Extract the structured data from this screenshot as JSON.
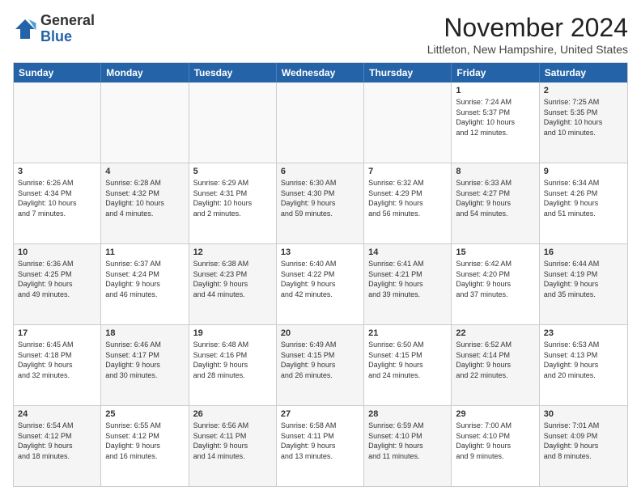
{
  "logo": {
    "general": "General",
    "blue": "Blue"
  },
  "header": {
    "month": "November 2024",
    "location": "Littleton, New Hampshire, United States"
  },
  "days": [
    "Sunday",
    "Monday",
    "Tuesday",
    "Wednesday",
    "Thursday",
    "Friday",
    "Saturday"
  ],
  "rows": [
    [
      {
        "num": "",
        "text": "",
        "empty": true
      },
      {
        "num": "",
        "text": "",
        "empty": true
      },
      {
        "num": "",
        "text": "",
        "empty": true
      },
      {
        "num": "",
        "text": "",
        "empty": true
      },
      {
        "num": "",
        "text": "",
        "empty": true
      },
      {
        "num": "1",
        "text": "Sunrise: 7:24 AM\nSunset: 5:37 PM\nDaylight: 10 hours\nand 12 minutes.",
        "alt": false
      },
      {
        "num": "2",
        "text": "Sunrise: 7:25 AM\nSunset: 5:35 PM\nDaylight: 10 hours\nand 10 minutes.",
        "alt": true
      }
    ],
    [
      {
        "num": "3",
        "text": "Sunrise: 6:26 AM\nSunset: 4:34 PM\nDaylight: 10 hours\nand 7 minutes.",
        "alt": false
      },
      {
        "num": "4",
        "text": "Sunrise: 6:28 AM\nSunset: 4:32 PM\nDaylight: 10 hours\nand 4 minutes.",
        "alt": true
      },
      {
        "num": "5",
        "text": "Sunrise: 6:29 AM\nSunset: 4:31 PM\nDaylight: 10 hours\nand 2 minutes.",
        "alt": false
      },
      {
        "num": "6",
        "text": "Sunrise: 6:30 AM\nSunset: 4:30 PM\nDaylight: 9 hours\nand 59 minutes.",
        "alt": true
      },
      {
        "num": "7",
        "text": "Sunrise: 6:32 AM\nSunset: 4:29 PM\nDaylight: 9 hours\nand 56 minutes.",
        "alt": false
      },
      {
        "num": "8",
        "text": "Sunrise: 6:33 AM\nSunset: 4:27 PM\nDaylight: 9 hours\nand 54 minutes.",
        "alt": true
      },
      {
        "num": "9",
        "text": "Sunrise: 6:34 AM\nSunset: 4:26 PM\nDaylight: 9 hours\nand 51 minutes.",
        "alt": false
      }
    ],
    [
      {
        "num": "10",
        "text": "Sunrise: 6:36 AM\nSunset: 4:25 PM\nDaylight: 9 hours\nand 49 minutes.",
        "alt": true
      },
      {
        "num": "11",
        "text": "Sunrise: 6:37 AM\nSunset: 4:24 PM\nDaylight: 9 hours\nand 46 minutes.",
        "alt": false
      },
      {
        "num": "12",
        "text": "Sunrise: 6:38 AM\nSunset: 4:23 PM\nDaylight: 9 hours\nand 44 minutes.",
        "alt": true
      },
      {
        "num": "13",
        "text": "Sunrise: 6:40 AM\nSunset: 4:22 PM\nDaylight: 9 hours\nand 42 minutes.",
        "alt": false
      },
      {
        "num": "14",
        "text": "Sunrise: 6:41 AM\nSunset: 4:21 PM\nDaylight: 9 hours\nand 39 minutes.",
        "alt": true
      },
      {
        "num": "15",
        "text": "Sunrise: 6:42 AM\nSunset: 4:20 PM\nDaylight: 9 hours\nand 37 minutes.",
        "alt": false
      },
      {
        "num": "16",
        "text": "Sunrise: 6:44 AM\nSunset: 4:19 PM\nDaylight: 9 hours\nand 35 minutes.",
        "alt": true
      }
    ],
    [
      {
        "num": "17",
        "text": "Sunrise: 6:45 AM\nSunset: 4:18 PM\nDaylight: 9 hours\nand 32 minutes.",
        "alt": false
      },
      {
        "num": "18",
        "text": "Sunrise: 6:46 AM\nSunset: 4:17 PM\nDaylight: 9 hours\nand 30 minutes.",
        "alt": true
      },
      {
        "num": "19",
        "text": "Sunrise: 6:48 AM\nSunset: 4:16 PM\nDaylight: 9 hours\nand 28 minutes.",
        "alt": false
      },
      {
        "num": "20",
        "text": "Sunrise: 6:49 AM\nSunset: 4:15 PM\nDaylight: 9 hours\nand 26 minutes.",
        "alt": true
      },
      {
        "num": "21",
        "text": "Sunrise: 6:50 AM\nSunset: 4:15 PM\nDaylight: 9 hours\nand 24 minutes.",
        "alt": false
      },
      {
        "num": "22",
        "text": "Sunrise: 6:52 AM\nSunset: 4:14 PM\nDaylight: 9 hours\nand 22 minutes.",
        "alt": true
      },
      {
        "num": "23",
        "text": "Sunrise: 6:53 AM\nSunset: 4:13 PM\nDaylight: 9 hours\nand 20 minutes.",
        "alt": false
      }
    ],
    [
      {
        "num": "24",
        "text": "Sunrise: 6:54 AM\nSunset: 4:12 PM\nDaylight: 9 hours\nand 18 minutes.",
        "alt": true
      },
      {
        "num": "25",
        "text": "Sunrise: 6:55 AM\nSunset: 4:12 PM\nDaylight: 9 hours\nand 16 minutes.",
        "alt": false
      },
      {
        "num": "26",
        "text": "Sunrise: 6:56 AM\nSunset: 4:11 PM\nDaylight: 9 hours\nand 14 minutes.",
        "alt": true
      },
      {
        "num": "27",
        "text": "Sunrise: 6:58 AM\nSunset: 4:11 PM\nDaylight: 9 hours\nand 13 minutes.",
        "alt": false
      },
      {
        "num": "28",
        "text": "Sunrise: 6:59 AM\nSunset: 4:10 PM\nDaylight: 9 hours\nand 11 minutes.",
        "alt": true
      },
      {
        "num": "29",
        "text": "Sunrise: 7:00 AM\nSunset: 4:10 PM\nDaylight: 9 hours\nand 9 minutes.",
        "alt": false
      },
      {
        "num": "30",
        "text": "Sunrise: 7:01 AM\nSunset: 4:09 PM\nDaylight: 9 hours\nand 8 minutes.",
        "alt": true
      }
    ]
  ]
}
